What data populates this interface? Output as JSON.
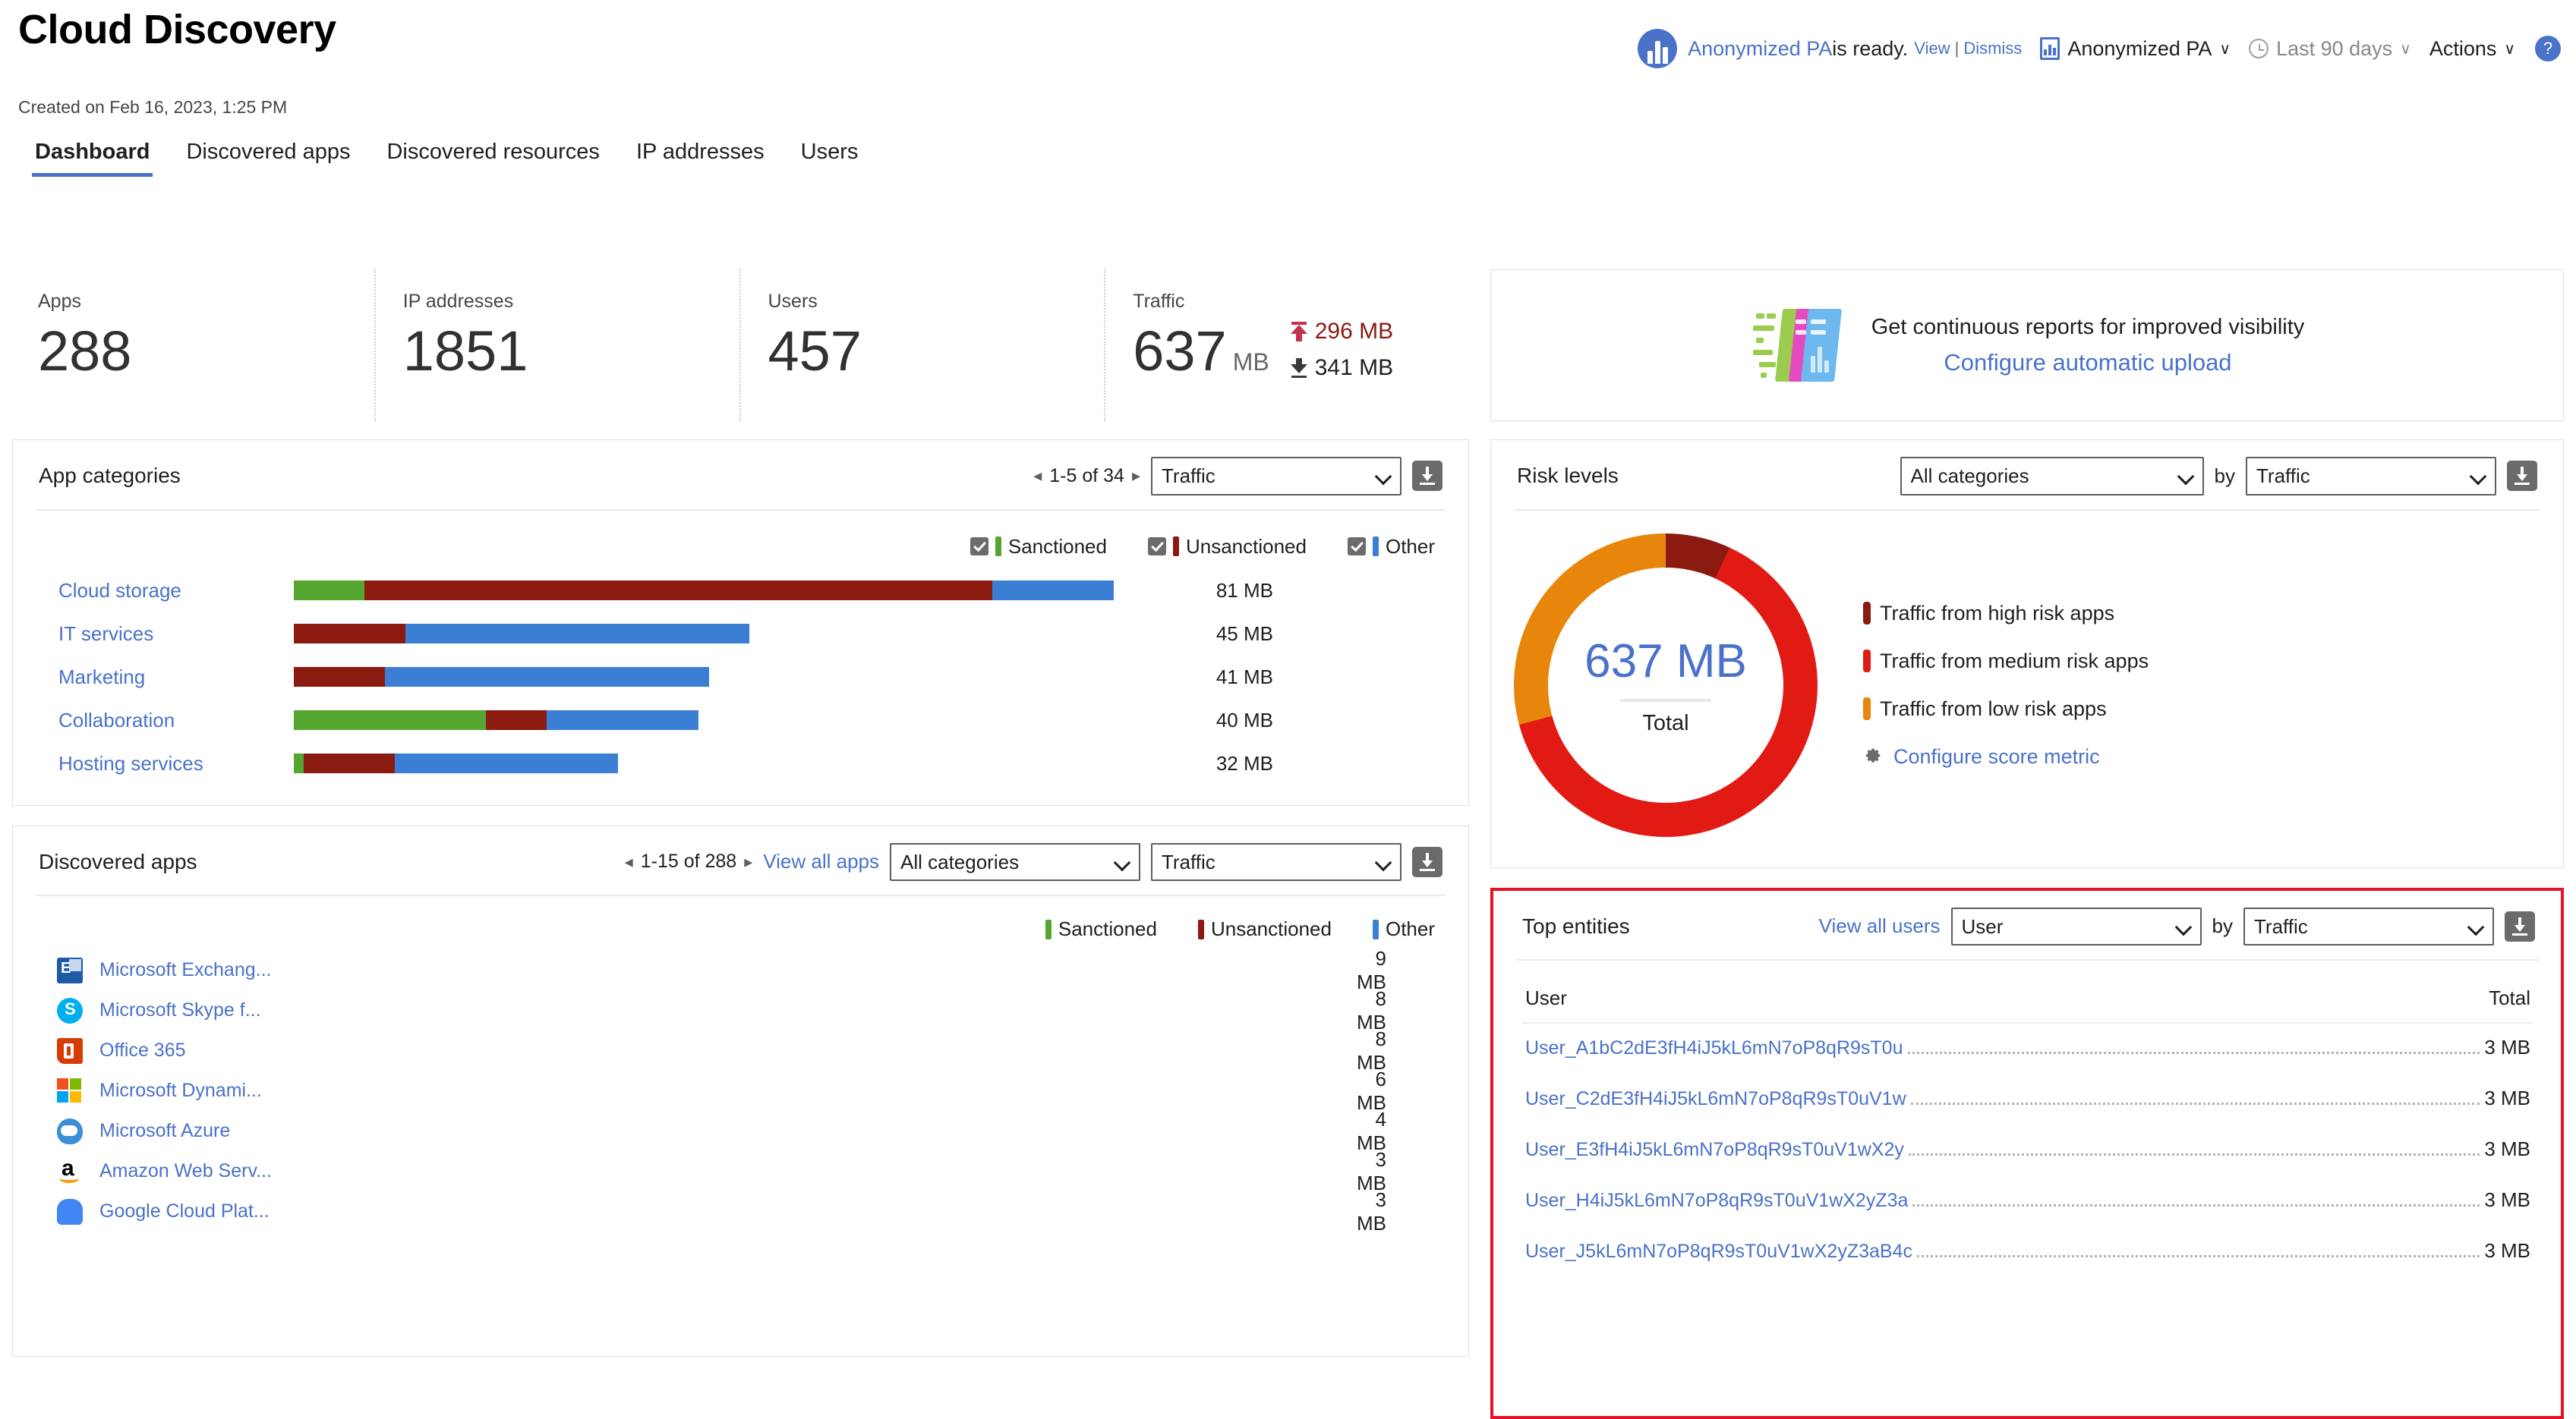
{
  "header": {
    "title": "Cloud Discovery",
    "created_on": "Created on Feb 16, 2023, 1:25 PM",
    "notification": {
      "link_text": "Anonymized PA",
      "message": " is ready.",
      "view": "View",
      "separator": "|",
      "dismiss": "Dismiss"
    },
    "report_selector": "Anonymized PA",
    "date_range": "Last 90 days",
    "actions": "Actions",
    "help": "?",
    "chevron": "∨"
  },
  "tabs": [
    {
      "label": "Dashboard",
      "active": true
    },
    {
      "label": "Discovered apps",
      "active": false
    },
    {
      "label": "Discovered resources",
      "active": false
    },
    {
      "label": "IP addresses",
      "active": false
    },
    {
      "label": "Users",
      "active": false
    }
  ],
  "kpis": [
    {
      "label": "Apps",
      "value": "288",
      "unit": ""
    },
    {
      "label": "IP addresses",
      "value": "1851",
      "unit": ""
    },
    {
      "label": "Users",
      "value": "457",
      "unit": ""
    },
    {
      "label": "Traffic",
      "value": "637",
      "unit": "MB",
      "upload": "296 MB",
      "download": "341 MB"
    }
  ],
  "promo": {
    "headline": "Get continuous reports for improved visibility",
    "link": "Configure automatic upload"
  },
  "app_categories": {
    "title": "App categories",
    "pager": "1-5 of 34",
    "prev": "◂",
    "next": "▸",
    "metric_select": "Traffic",
    "legend": [
      {
        "label": "Sanctioned",
        "color": "#55a630",
        "checked": true
      },
      {
        "label": "Unsanctioned",
        "color": "#8b1a10",
        "checked": true
      },
      {
        "label": "Other",
        "color": "#3b7fd4",
        "checked": true
      }
    ]
  },
  "risk_levels": {
    "title": "Risk levels",
    "category_select": "All categories",
    "by_label": "by",
    "metric_select": "Traffic",
    "center_value": "637 MB",
    "center_label": "Total",
    "legend": [
      {
        "label": "Traffic from high risk apps",
        "color": "#8b1a10"
      },
      {
        "label": "Traffic from medium risk apps",
        "color": "#e11b13"
      },
      {
        "label": "Traffic from low risk apps",
        "color": "#e8860c"
      }
    ],
    "configure_link": "Configure score metric"
  },
  "discovered_apps": {
    "title": "Discovered apps",
    "pager": "1-15 of 288",
    "prev": "◂",
    "next": "▸",
    "view_all": "View all apps",
    "category_select": "All categories",
    "metric_select": "Traffic",
    "legend": [
      {
        "label": "Sanctioned",
        "color": "#55a630"
      },
      {
        "label": "Unsanctioned",
        "color": "#8b1a10"
      },
      {
        "label": "Other",
        "color": "#3b7fd4"
      }
    ]
  },
  "top_entities": {
    "title": "Top entities",
    "view_all": "View all users",
    "entity_select": "User",
    "by_label": "by",
    "metric_select": "Traffic",
    "col_user": "User",
    "col_total": "Total",
    "highlight_color": "#e81123"
  },
  "chart_data": [
    {
      "type": "bar",
      "title": "App categories",
      "orientation": "horizontal",
      "stacked": true,
      "unit": "MB",
      "categories": [
        "Cloud storage",
        "IT services",
        "Marketing",
        "Collaboration",
        "Hosting services"
      ],
      "totals": [
        81,
        45,
        41,
        40,
        32
      ],
      "total_labels": [
        "81 MB",
        "45 MB",
        "41 MB",
        "40 MB",
        "32 MB"
      ],
      "series": [
        {
          "name": "Sanctioned",
          "color": "#55a630",
          "values": [
            7,
            0,
            0,
            19,
            1
          ]
        },
        {
          "name": "Unsanctioned",
          "color": "#8b1a10",
          "values": [
            62,
            11,
            9,
            6,
            9
          ]
        },
        {
          "name": "Other",
          "color": "#3b7fd4",
          "values": [
            12,
            34,
            32,
            15,
            22
          ]
        }
      ],
      "xlabel": "",
      "ylabel": "",
      "grid": false,
      "legend_position": "top-right"
    },
    {
      "type": "pie",
      "variant": "donut",
      "title": "Risk levels",
      "center_value": "637 MB",
      "center_label": "Total",
      "unit": "MB",
      "labels": [
        "Traffic from high risk apps",
        "Traffic from medium risk apps",
        "Traffic from low risk apps"
      ],
      "values": [
        44,
        407,
        186
      ],
      "percent": [
        7,
        64,
        29
      ],
      "colors": [
        "#8b1a10",
        "#e11b13",
        "#e8860c"
      ],
      "legend_position": "right"
    },
    {
      "type": "bar",
      "title": "Discovered apps",
      "orientation": "horizontal",
      "unit": "MB",
      "categories": [
        "Microsoft Exchang...",
        "Microsoft Skype f...",
        "Office 365",
        "Microsoft Dynami...",
        "Microsoft Azure",
        "Amazon Web Serv...",
        "Google Cloud Plat..."
      ],
      "values": [
        9,
        8,
        8,
        6,
        4,
        3,
        3
      ],
      "value_labels": [
        "9 MB",
        "8 MB",
        "8 MB",
        "6 MB",
        "4 MB",
        "3 MB",
        "3 MB"
      ],
      "bar_color": "#55a630",
      "icons": [
        "exchange-icon",
        "skype-icon",
        "office365-icon",
        "dynamics-icon",
        "azure-icon",
        "aws-icon",
        "gcp-icon"
      ],
      "xlabel": "",
      "ylabel": "",
      "grid": false,
      "legend_position": "top-right"
    },
    {
      "type": "table",
      "title": "Top entities",
      "columns": [
        "User",
        "Total"
      ],
      "rows": [
        [
          "User_A1bC2dE3fH4iJ5kL6mN7oP8qR9sT0u",
          "3 MB"
        ],
        [
          "User_C2dE3fH4iJ5kL6mN7oP8qR9sT0uV1w",
          "3 MB"
        ],
        [
          "User_E3fH4iJ5kL6mN7oP8qR9sT0uV1wX2y",
          "3 MB"
        ],
        [
          "User_H4iJ5kL6mN7oP8qR9sT0uV1wX2yZ3a",
          "3 MB"
        ],
        [
          "User_J5kL6mN7oP8qR9sT0uV1wX2yZ3aB4c",
          "3 MB"
        ]
      ]
    }
  ]
}
